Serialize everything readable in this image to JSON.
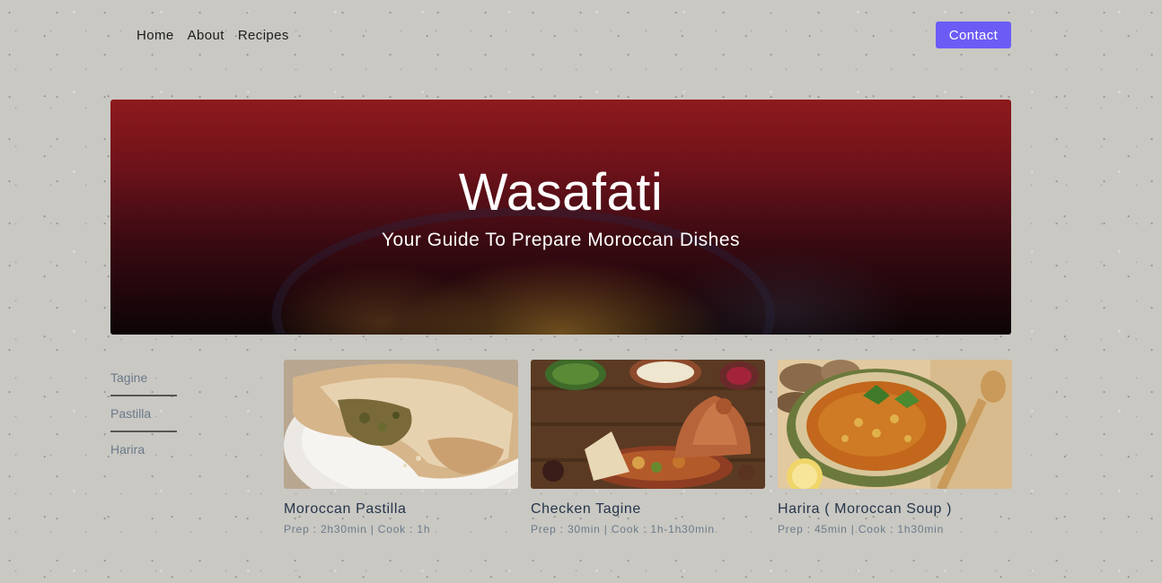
{
  "nav": {
    "links": [
      "Home",
      "About",
      "Recipes"
    ],
    "contact_label": "Contact",
    "accent": "#6c5cf5"
  },
  "hero": {
    "title": "Wasafati",
    "subtitle": "Your Guide To Prepare Moroccan Dishes"
  },
  "sidebar": {
    "items": [
      "Tagine",
      "Pastilla",
      "Harira"
    ]
  },
  "recipes": [
    {
      "title": "Moroccan Pastilla",
      "meta": "Prep : 2h30min | Cook : 1h",
      "image": "pastilla-photo"
    },
    {
      "title": "Checken Tagine",
      "meta": "Prep : 30min | Cook : 1h-1h30min",
      "image": "tagine-photo"
    },
    {
      "title": "Harira ( Moroccan Soup )",
      "meta": "Prep : 45min | Cook : 1h30min",
      "image": "harira-photo"
    }
  ]
}
